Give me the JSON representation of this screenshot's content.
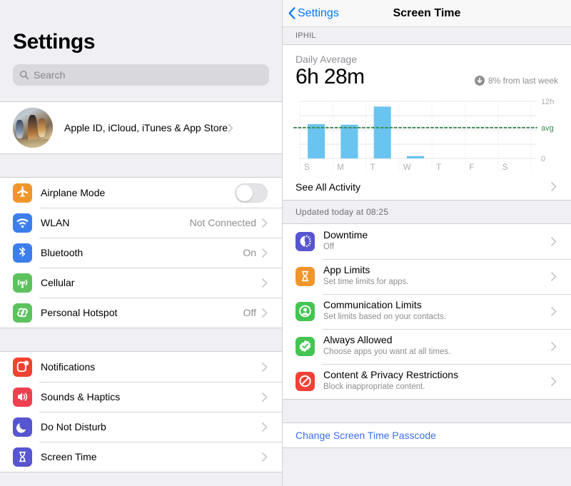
{
  "settings_pane": {
    "title": "Settings",
    "search": {
      "placeholder": "Search",
      "icon": "search-icon"
    },
    "apple_id": {
      "label": "Apple ID, iCloud, iTunes & App Store",
      "avatar": "user-avatar-photo",
      "chevron": "chevron-right-icon"
    },
    "group_connectivity": [
      {
        "label": "Airplane Mode",
        "icon": "airplane-icon",
        "icon_color": "#f0952c",
        "control": "toggle",
        "toggle_on": false
      },
      {
        "label": "WLAN",
        "icon": "wifi-icon",
        "icon_color": "#3d7eed",
        "value": "Not Connected",
        "control": "chevron"
      },
      {
        "label": "Bluetooth",
        "icon": "bluetooth-icon",
        "icon_color": "#3d7eed",
        "value": "On",
        "control": "chevron"
      },
      {
        "label": "Cellular",
        "icon": "cellular-antenna-icon",
        "icon_color": "#5dc25e",
        "value": "",
        "control": "chevron"
      },
      {
        "label": "Personal Hotspot",
        "icon": "hotspot-link-icon",
        "icon_color": "#5dc25e",
        "value": "Off",
        "control": "chevron"
      }
    ],
    "group_notifications": [
      {
        "label": "Notifications",
        "icon": "notifications-badge-icon",
        "icon_color": "#f2412e",
        "value": "",
        "control": "chevron"
      },
      {
        "label": "Sounds & Haptics",
        "icon": "speaker-waves-icon",
        "icon_color": "#ef4050",
        "value": "",
        "control": "chevron"
      },
      {
        "label": "Do Not Disturb",
        "icon": "moon-icon",
        "icon_color": "#5755d1",
        "value": "",
        "control": "chevron"
      },
      {
        "label": "Screen Time",
        "icon": "hourglass-icon",
        "icon_color": "#5755d1",
        "value": "",
        "control": "chevron"
      }
    ]
  },
  "screen_time_pane": {
    "nav": {
      "back_label": "Settings",
      "back_icon": "chevron-left-icon",
      "title": "Screen Time"
    },
    "device_header": "IPHIL",
    "summary": {
      "label": "Daily Average",
      "value": "6h 28m",
      "delta_icon": "arrow-down-circle-icon",
      "delta_text": "8% from last week"
    },
    "see_all": {
      "label": "See All Activity",
      "chevron": "chevron-right-icon"
    },
    "updated_note": "Updated today at 08:25",
    "features": [
      {
        "title": "Downtime",
        "subtitle": "Off",
        "icon": "downtime-clock-icon",
        "icon_color": "#5755d1"
      },
      {
        "title": "App Limits",
        "subtitle": "Set time limits for apps.",
        "icon": "hourglass-icon",
        "icon_color": "#f0952c"
      },
      {
        "title": "Communication Limits",
        "subtitle": "Set limits based on your contacts.",
        "icon": "person-circle-icon",
        "icon_color": "#44c553"
      },
      {
        "title": "Always Allowed",
        "subtitle": "Choose apps you want at all times.",
        "icon": "checkmark-seal-icon",
        "icon_color": "#44c553"
      },
      {
        "title": "Content & Privacy Restrictions",
        "subtitle": "Block inappropriate content.",
        "icon": "no-entry-icon",
        "icon_color": "#ef4136"
      }
    ],
    "passcode_link": "Change Screen Time Passcode"
  },
  "chart_data": {
    "type": "bar",
    "title": "Daily Average",
    "categories": [
      "S",
      "M",
      "T",
      "W",
      "T",
      "F",
      "S"
    ],
    "values": [
      7.2,
      7.1,
      10.9,
      0.5,
      0,
      0,
      0
    ],
    "unit": "hours",
    "ylim": [
      0,
      12
    ],
    "ytick_labels": [
      "12h",
      "0"
    ],
    "ytick_values": [
      12,
      0
    ],
    "gridlines": [
      0,
      3,
      6,
      9,
      12
    ],
    "average_line": {
      "value": 6.47,
      "label": "avg",
      "color": "#3d8b54",
      "style": "dotted"
    },
    "bar_color": "#6ac4f0",
    "grid": true,
    "legend": "none",
    "xlabel": "",
    "ylabel": ""
  },
  "colors": {
    "accent_blue": "#007aff",
    "link_blue": "#3c6ef5",
    "bar_blue": "#6ac4f0",
    "avg_green": "#3d8b54",
    "group_bg": "#efeff4",
    "card_bg": "#ffffff",
    "secondary_text": "#8e8e93"
  }
}
